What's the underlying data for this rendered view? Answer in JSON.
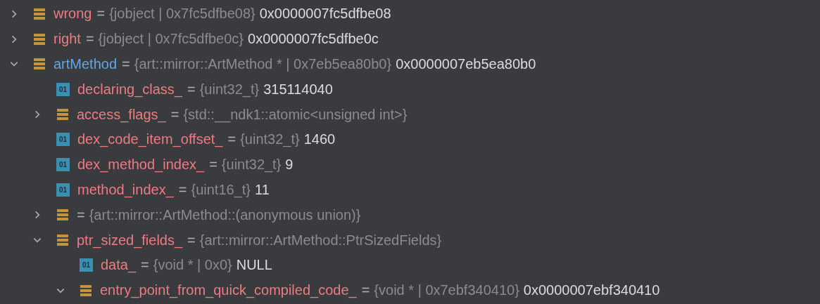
{
  "separator": "=",
  "variables": [
    {
      "name": "wrong",
      "color": "#ef7b80",
      "kind": "object",
      "expanded": false,
      "type": "{jobject | 0x7fc5dfbe08}",
      "value": "0x0000007fc5dfbe08"
    },
    {
      "name": "right",
      "color": "#ef7b80",
      "kind": "object",
      "expanded": false,
      "type": "{jobject | 0x7fc5dfbe0c}",
      "value": "0x0000007fc5dfbe0c"
    },
    {
      "name": "artMethod",
      "color": "#5ea6ee",
      "kind": "object",
      "expanded": true,
      "type": "{art::mirror::ArtMethod * | 0x7eb5ea80b0}",
      "value": "0x0000007eb5ea80b0",
      "children": [
        {
          "name": "declaring_class_",
          "color": "#ef7b80",
          "kind": "primitive",
          "badge": "01",
          "type": "{uint32_t}",
          "value": "315114040"
        },
        {
          "name": "access_flags_",
          "color": "#ef7b80",
          "kind": "object",
          "expanded": false,
          "type": "{std::__ndk1::atomic<unsigned int>}"
        },
        {
          "name": "dex_code_item_offset_",
          "color": "#ef7b80",
          "kind": "primitive",
          "badge": "01",
          "type": "{uint32_t}",
          "value": "1460"
        },
        {
          "name": "dex_method_index_",
          "color": "#ef7b80",
          "kind": "primitive",
          "badge": "01",
          "type": "{uint32_t}",
          "value": "9"
        },
        {
          "name": "method_index_",
          "color": "#ef7b80",
          "kind": "primitive",
          "badge": "01",
          "type": "{uint16_t}",
          "value": "11"
        },
        {
          "kind": "object",
          "expanded": false,
          "type": "{art::mirror::ArtMethod::(anonymous union)}"
        },
        {
          "name": "ptr_sized_fields_",
          "color": "#ef7b80",
          "kind": "object",
          "expanded": true,
          "type": "{art::mirror::ArtMethod::PtrSizedFields}",
          "children": [
            {
              "name": "data_",
              "color": "#ef7b80",
              "kind": "primitive",
              "badge": "01",
              "type": "{void * | 0x0}",
              "value": "NULL"
            },
            {
              "name": "entry_point_from_quick_compiled_code_",
              "color": "#ef7b80",
              "kind": "object",
              "expanded": true,
              "type": "{void * | 0x7ebf340410}",
              "value": "0x0000007ebf340410"
            }
          ]
        }
      ]
    }
  ]
}
